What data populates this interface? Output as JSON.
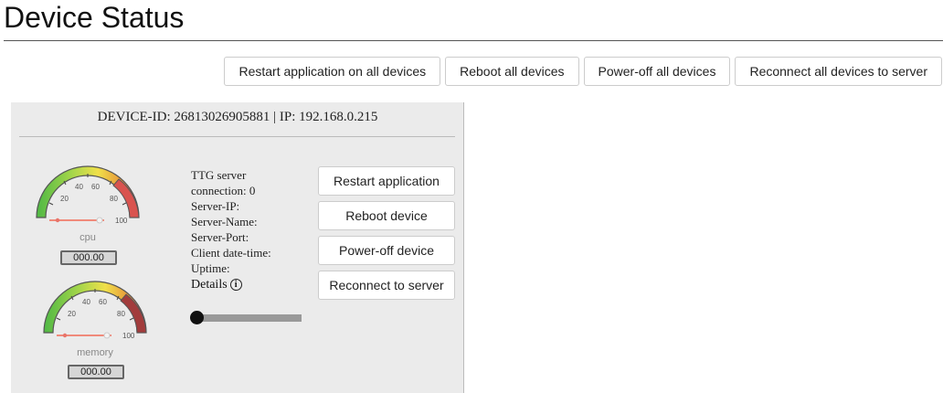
{
  "page": {
    "title": "Device Status"
  },
  "global_actions": [
    {
      "label": "Restart application on all devices"
    },
    {
      "label": "Reboot all devices"
    },
    {
      "label": "Power-off all devices"
    },
    {
      "label": "Reconnect all devices to server"
    }
  ],
  "device": {
    "header": "DEVICE-ID: 26813026905881 | IP: 192.168.0.215",
    "cpu_gauge": {
      "label": "cpu",
      "value": "000.00",
      "ticks": [
        "20",
        "40",
        "60",
        "80",
        "100"
      ]
    },
    "memory_gauge": {
      "label": "memory",
      "value": "000.00",
      "ticks": [
        "20",
        "40",
        "60",
        "80",
        "100"
      ]
    },
    "info": {
      "ttg_line1": "TTG server",
      "ttg_line2": "connection: 0",
      "server_ip": "Server-IP:",
      "server_name": "Server-Name:",
      "server_port": "Server-Port:",
      "client_datetime": "Client date-time:",
      "uptime": "Uptime:",
      "details": "Details",
      "details_icon_glyph": "i"
    },
    "slider_value": 0,
    "actions": [
      {
        "label": "Restart application"
      },
      {
        "label": "Reboot device"
      },
      {
        "label": "Power-off device"
      },
      {
        "label": "Reconnect to server"
      }
    ]
  },
  "colors": {
    "gauge_green": "#6cc04a",
    "gauge_yellow": "#e8d53a",
    "gauge_red": "#d9534f",
    "card_bg": "#ebebeb"
  }
}
